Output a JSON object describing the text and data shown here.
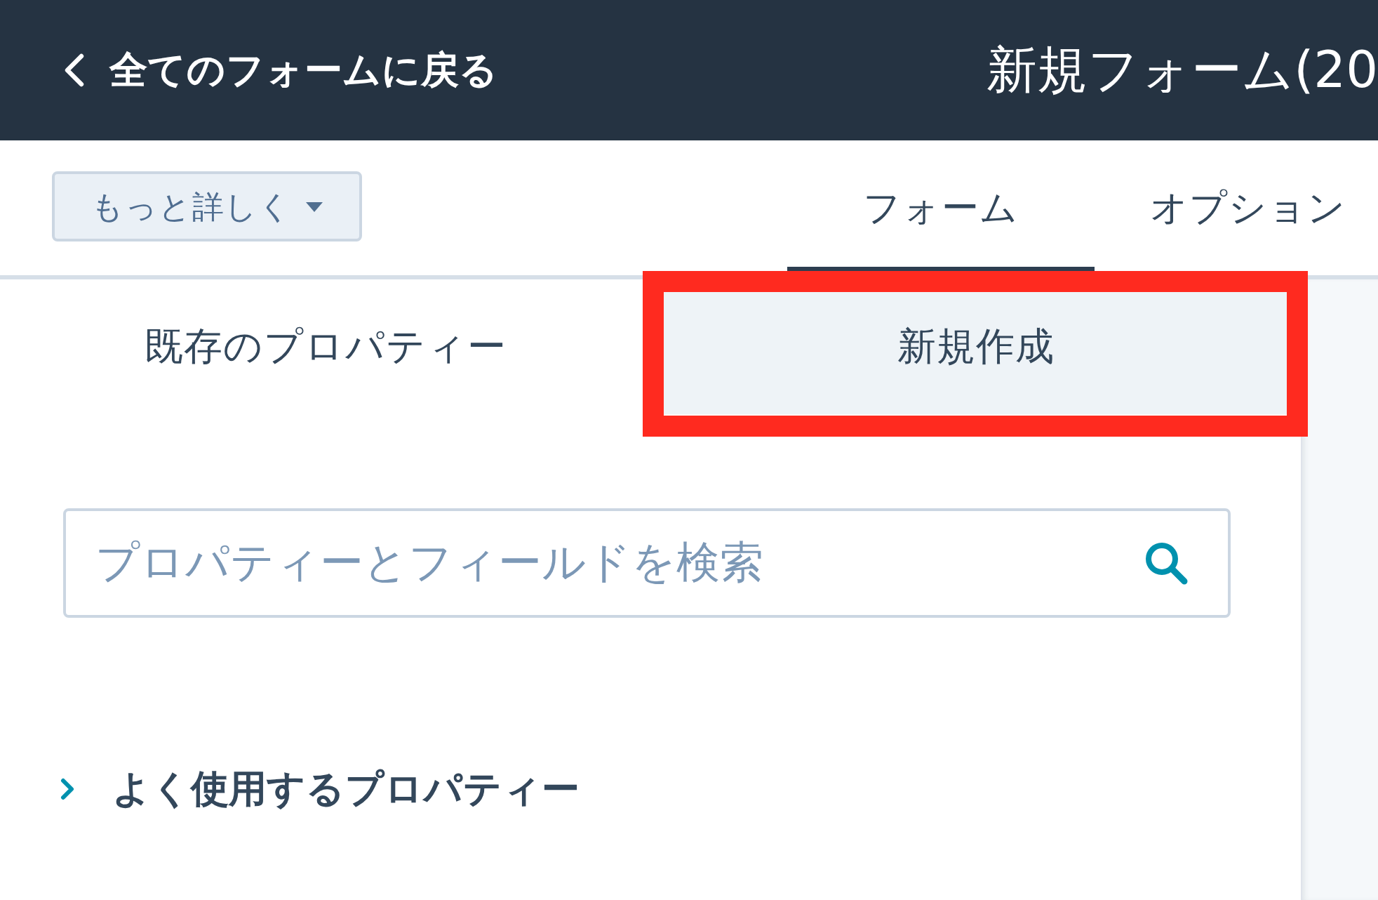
{
  "header": {
    "back_link": "全てのフォームに戻る",
    "title": "新規フォーム(20"
  },
  "toolbar": {
    "more_button": "もっと詳しく",
    "tabs": [
      {
        "label": "フォーム",
        "selected": true
      },
      {
        "label": "オプション",
        "selected": false
      }
    ]
  },
  "panel": {
    "tabs": [
      {
        "label": "既存のプロパティー",
        "selected": true,
        "highlighted": false
      },
      {
        "label": "新規作成",
        "selected": false,
        "highlighted": true
      }
    ],
    "search": {
      "placeholder": "プロパティーとフィールドを検索"
    },
    "sections": [
      {
        "label": "よく使用するプロパティー",
        "expanded": false
      }
    ]
  }
}
